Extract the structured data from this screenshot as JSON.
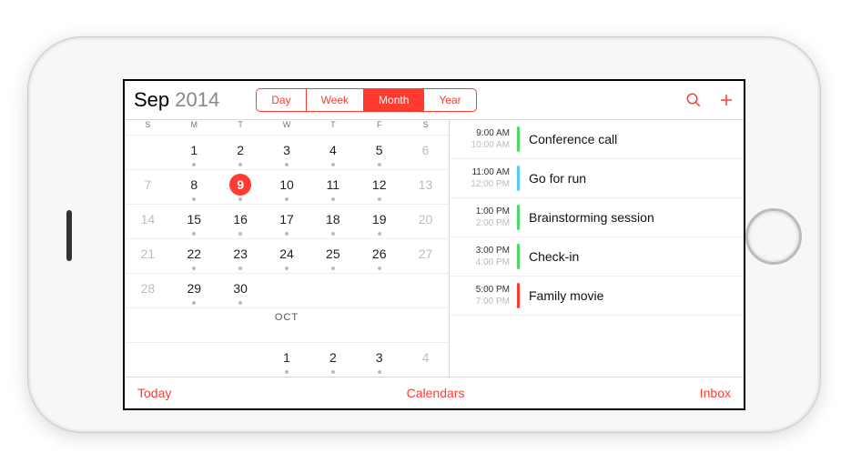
{
  "header": {
    "month": "Sep",
    "year": "2014",
    "segments": [
      "Day",
      "Week",
      "Month",
      "Year"
    ],
    "active_segment": "Month"
  },
  "dow": [
    "S",
    "M",
    "T",
    "W",
    "T",
    "F",
    "S"
  ],
  "weeks": [
    [
      null,
      {
        "n": 1,
        "dot": true
      },
      {
        "n": 2,
        "dot": true
      },
      {
        "n": 3,
        "dot": true
      },
      {
        "n": 4,
        "dot": true
      },
      {
        "n": 5,
        "dot": true
      },
      {
        "n": 6,
        "dim": true
      }
    ],
    [
      {
        "n": 7,
        "dim": true
      },
      {
        "n": 8,
        "dot": true
      },
      {
        "n": 9,
        "today": true
      },
      {
        "n": 10,
        "dot": true
      },
      {
        "n": 11,
        "dot": true
      },
      {
        "n": 12,
        "dot": true
      },
      {
        "n": 13,
        "dim": true
      }
    ],
    [
      {
        "n": 14,
        "dim": true
      },
      {
        "n": 15,
        "dot": true
      },
      {
        "n": 16,
        "dot": true
      },
      {
        "n": 17,
        "dot": true
      },
      {
        "n": 18,
        "dot": true
      },
      {
        "n": 19,
        "dot": true
      },
      {
        "n": 20,
        "dim": true
      }
    ],
    [
      {
        "n": 21,
        "dim": true
      },
      {
        "n": 22,
        "dot": true
      },
      {
        "n": 23,
        "dot": true
      },
      {
        "n": 24,
        "dot": true
      },
      {
        "n": 25,
        "dot": true
      },
      {
        "n": 26,
        "dot": true
      },
      {
        "n": 27,
        "dim": true
      }
    ],
    [
      {
        "n": 28,
        "dim": true
      },
      {
        "n": 29,
        "dot": true
      },
      {
        "n": 30,
        "dot": true
      },
      null,
      null,
      null,
      null
    ]
  ],
  "next_month_label": "OCT",
  "next_month_row": [
    null,
    null,
    null,
    {
      "n": 1,
      "dot": true
    },
    {
      "n": 2,
      "dot": true
    },
    {
      "n": 3,
      "dot": true
    },
    {
      "n": 4,
      "dim": true
    }
  ],
  "events": [
    {
      "start": "9:00 AM",
      "end": "10:00 AM",
      "title": "Conference call",
      "color": "#4cd964"
    },
    {
      "start": "11:00 AM",
      "end": "12:00 PM",
      "title": "Go for run",
      "color": "#5ac8fa"
    },
    {
      "start": "1:00 PM",
      "end": "2:00 PM",
      "title": "Brainstorming session",
      "color": "#4cd964"
    },
    {
      "start": "3:00 PM",
      "end": "4:00 PM",
      "title": "Check-in",
      "color": "#4cd964"
    },
    {
      "start": "5:00 PM",
      "end": "7:00 PM",
      "title": "Family movie",
      "color": "#ff3b30"
    }
  ],
  "footer": {
    "today": "Today",
    "calendars": "Calendars",
    "inbox": "Inbox"
  },
  "colors": {
    "accent": "#ff3b30"
  }
}
